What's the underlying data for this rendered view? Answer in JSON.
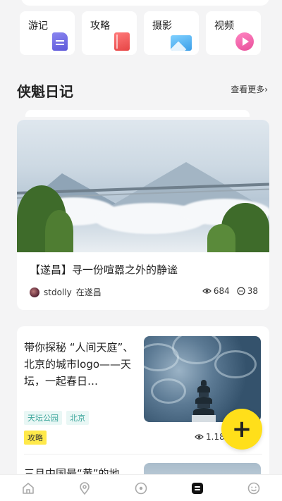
{
  "categories": [
    {
      "label": "游记",
      "icon": "note-icon"
    },
    {
      "label": "攻略",
      "icon": "book-icon"
    },
    {
      "label": "摄影",
      "icon": "photo-icon"
    },
    {
      "label": "视频",
      "icon": "video-play-icon"
    }
  ],
  "section": {
    "title": "侠魁日记",
    "more": "查看更多›"
  },
  "featured": {
    "title": "【遂昌】寻一份喧嚣之外的静谧",
    "author": "stdolly",
    "location": "在遂昌",
    "views": "684",
    "comments": "38"
  },
  "posts": [
    {
      "title": "带你探秘 “人间天庭”、北京的城市logo——天坛，一起春日…",
      "tags": [
        "天坛公园",
        "北京"
      ],
      "type_tag": "攻略",
      "views": "1.18"
    },
    {
      "title": "三月中国最“黄”的地"
    }
  ],
  "fab": {
    "label": "+"
  },
  "tabbar": [
    "home-icon",
    "location-pin-icon",
    "compass-icon",
    "notebook-icon",
    "smiley-face-icon"
  ],
  "colors": {
    "accent": "#ffdf1a",
    "tag_green": "#3aa59a",
    "tag_yellow": "#ffe94a"
  }
}
